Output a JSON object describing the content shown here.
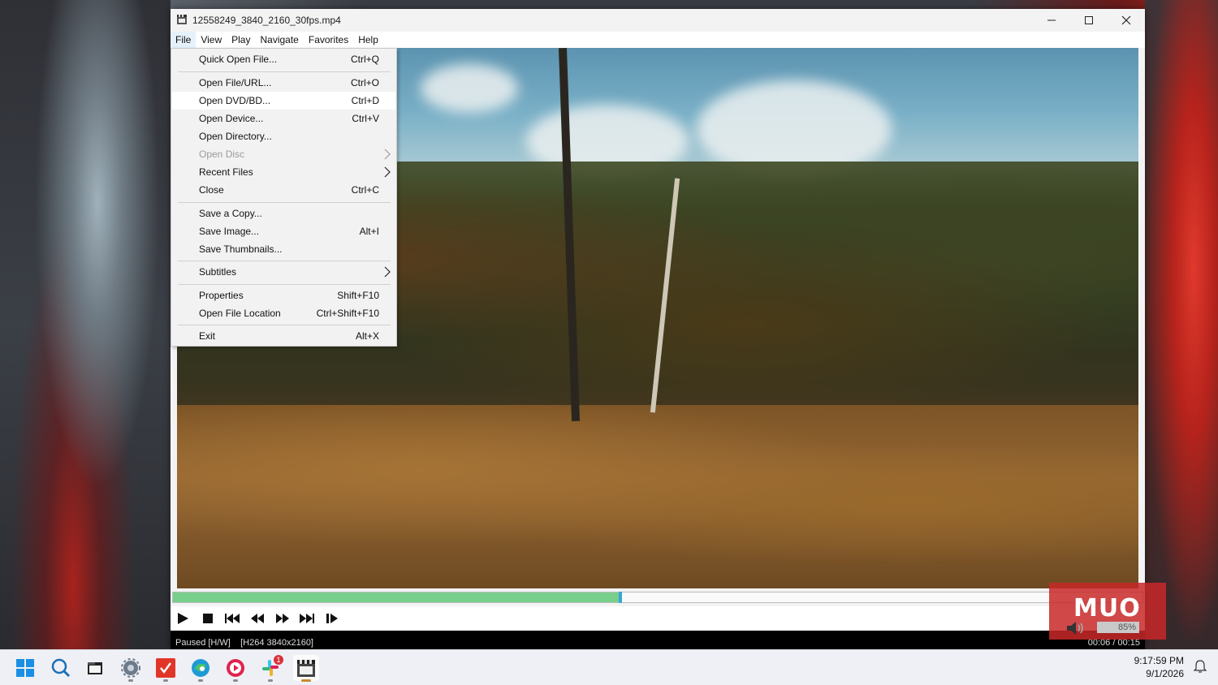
{
  "window": {
    "title": "12558249_3840_2160_30fps.mp4",
    "icon": "film-clapper-icon"
  },
  "menubar": [
    "File",
    "View",
    "Play",
    "Navigate",
    "Favorites",
    "Help"
  ],
  "file_menu": [
    {
      "label": "Quick Open File...",
      "shortcut": "Ctrl+Q"
    },
    {
      "label": "Open File/URL...",
      "shortcut": "Ctrl+O"
    },
    {
      "label": "Open DVD/BD...",
      "shortcut": "Ctrl+D"
    },
    {
      "label": "Open Device...",
      "shortcut": "Ctrl+V"
    },
    {
      "label": "Open Directory...",
      "shortcut": ""
    },
    {
      "label": "Open Disc",
      "shortcut": ""
    },
    {
      "label": "Recent Files",
      "shortcut": ""
    },
    {
      "label": "Close",
      "shortcut": "Ctrl+C"
    },
    {
      "label": "Save a Copy...",
      "shortcut": ""
    },
    {
      "label": "Save Image...",
      "shortcut": "Alt+I"
    },
    {
      "label": "Save Thumbnails...",
      "shortcut": ""
    },
    {
      "label": "Subtitles",
      "shortcut": ""
    },
    {
      "label": "Properties",
      "shortcut": "Shift+F10"
    },
    {
      "label": "Open File Location",
      "shortcut": "Ctrl+Shift+F10"
    },
    {
      "label": "Exit",
      "shortcut": "Alt+X"
    }
  ],
  "playback": {
    "progress": 0.46,
    "volume_label": "85%",
    "watermark": "MUO"
  },
  "status": {
    "left": "Paused [H/W]    [H264 3840x2160]",
    "right": "00:06 / 00:15"
  },
  "taskbar": {
    "apps": [
      "windows-start-icon",
      "search-icon",
      "file-explorer-icon",
      "settings-icon",
      "todo-app-icon",
      "edge-browser-icon",
      "media-player-icon",
      "slack-icon",
      "mpc-hc-icon"
    ],
    "slack_badge": "1",
    "time": "9:17:59 PM",
    "date": "9/1/2026"
  },
  "colors": {
    "seek_fill": "#78cf8c",
    "seek_thumb": "#3aa6d0",
    "menu_bg": "#f2f2f2",
    "watermark_bg": "#c82828"
  }
}
